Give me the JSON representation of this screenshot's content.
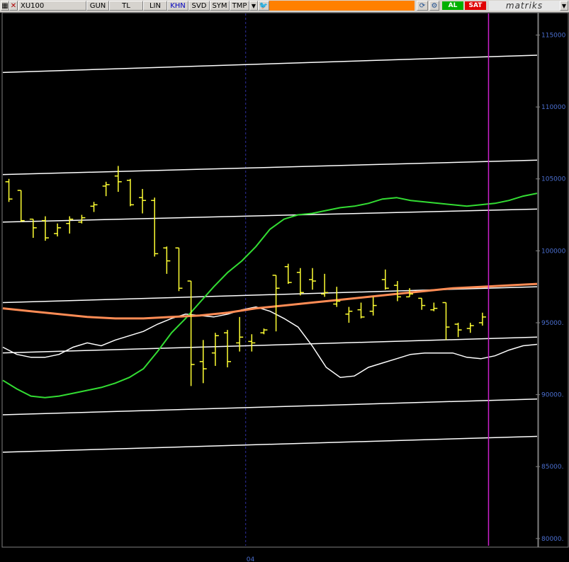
{
  "toolbar": {
    "symbol": "XU100",
    "buttons": [
      "GUN",
      "TL",
      "LIN",
      "KHN",
      "SVD",
      "SYM",
      "TMP"
    ],
    "active_button": "KHN",
    "buy_label": "AL",
    "sell_label": "SAT",
    "brand": "matriks"
  },
  "colors": {
    "price": "#ffff33",
    "channel": "#ffffff",
    "ma_green": "#33dd33",
    "ma_white": "#ffffff",
    "ma_orange": "#ff8c55",
    "cursor": "#cc22cc",
    "grid": "#3030a0",
    "axis_text": "#4b6fd0"
  },
  "chart_data": {
    "type": "ohlc",
    "ylim": [
      79500,
      116500
    ],
    "y_ticks": [
      80000,
      85000,
      90000,
      95000,
      100000,
      105000,
      110000,
      115000
    ],
    "y_tick_labels": [
      "80000.",
      "85000.",
      "90000.",
      "95000.",
      "100000",
      "105000",
      "110000",
      "115000"
    ],
    "x_tick_labels": [
      {
        "index": 20,
        "label": "04"
      }
    ],
    "bar_count": 44,
    "ohlc": [
      [
        104800,
        105000,
        103400,
        103600
      ],
      [
        104200,
        104200,
        102000,
        102100
      ],
      [
        102200,
        102200,
        100900,
        101600
      ],
      [
        102100,
        102400,
        100700,
        100900
      ],
      [
        101200,
        101900,
        101000,
        101600
      ],
      [
        101900,
        102400,
        101200,
        102200
      ],
      [
        102000,
        102500,
        101900,
        102300
      ],
      [
        103100,
        103400,
        102700,
        103200
      ],
      [
        104500,
        104800,
        103800,
        104600
      ],
      [
        105200,
        105900,
        104100,
        104800
      ],
      [
        104900,
        105000,
        103100,
        103200
      ],
      [
        103700,
        104300,
        102600,
        103500
      ],
      [
        103500,
        103700,
        99600,
        99800
      ],
      [
        100200,
        100300,
        98400,
        99300
      ],
      [
        100200,
        100200,
        97200,
        97400
      ],
      [
        97900,
        97900,
        90600,
        92100
      ],
      [
        92300,
        93800,
        90800,
        91800
      ],
      [
        92900,
        94300,
        92000,
        94100
      ],
      [
        94300,
        94500,
        91900,
        92300
      ],
      [
        93600,
        95400,
        93000,
        94000
      ],
      [
        93700,
        94200,
        93000,
        93600
      ],
      [
        94300,
        94600,
        94200,
        94500
      ],
      [
        98300,
        98300,
        94400,
        97400
      ],
      [
        98900,
        99100,
        97700,
        97800
      ],
      [
        98500,
        98800,
        96900,
        97100
      ],
      [
        98000,
        98800,
        97300,
        97900
      ],
      [
        97000,
        98400,
        96800,
        97100
      ],
      [
        96300,
        97500,
        96100,
        96500
      ],
      [
        95600,
        96100,
        95000,
        95800
      ],
      [
        95900,
        96400,
        95300,
        95400
      ],
      [
        95800,
        96800,
        95500,
        96200
      ],
      [
        98000,
        98700,
        97300,
        97400
      ],
      [
        97600,
        97900,
        96500,
        96800
      ],
      [
        96800,
        97400,
        96800,
        97000
      ],
      [
        96700,
        96700,
        95900,
        96200
      ],
      [
        95900,
        96400,
        95800,
        96000
      ],
      [
        96400,
        96400,
        93800,
        94700
      ],
      [
        94900,
        95000,
        94000,
        94500
      ],
      [
        94600,
        95000,
        94300,
        94800
      ],
      [
        95000,
        95700,
        94800,
        95400
      ]
    ],
    "channel_lines": [
      [
        112400,
        113600
      ],
      [
        105300,
        106300
      ],
      [
        102000,
        102900
      ],
      [
        96400,
        97500
      ],
      [
        92900,
        94000
      ],
      [
        88600,
        89700
      ],
      [
        86000,
        87100
      ]
    ],
    "green_line": [
      [
        0,
        91000
      ],
      [
        2,
        90400
      ],
      [
        4,
        89900
      ],
      [
        6,
        89800
      ],
      [
        8,
        89900
      ],
      [
        10,
        90100
      ],
      [
        12,
        90300
      ],
      [
        14,
        90500
      ],
      [
        16,
        90800
      ],
      [
        18,
        91200
      ],
      [
        20,
        91800
      ],
      [
        22,
        93000
      ],
      [
        24,
        94300
      ],
      [
        26,
        95300
      ],
      [
        28,
        96400
      ],
      [
        30,
        97500
      ],
      [
        32,
        98500
      ],
      [
        34,
        99300
      ],
      [
        36,
        100300
      ],
      [
        38,
        101500
      ],
      [
        40,
        102200
      ],
      [
        42,
        102500
      ],
      [
        44,
        102600
      ],
      [
        46,
        102800
      ],
      [
        48,
        103000
      ],
      [
        50,
        103100
      ],
      [
        52,
        103300
      ],
      [
        54,
        103600
      ],
      [
        56,
        103700
      ],
      [
        58,
        103500
      ],
      [
        60,
        103400
      ],
      [
        62,
        103300
      ],
      [
        64,
        103200
      ],
      [
        66,
        103100
      ],
      [
        68,
        103200
      ],
      [
        70,
        103300
      ],
      [
        72,
        103500
      ],
      [
        74,
        103800
      ],
      [
        76,
        104000
      ]
    ],
    "white_line": [
      [
        0,
        93300
      ],
      [
        2,
        92800
      ],
      [
        4,
        92600
      ],
      [
        6,
        92600
      ],
      [
        8,
        92800
      ],
      [
        10,
        93300
      ],
      [
        12,
        93600
      ],
      [
        14,
        93400
      ],
      [
        16,
        93800
      ],
      [
        18,
        94100
      ],
      [
        20,
        94400
      ],
      [
        22,
        94900
      ],
      [
        24,
        95300
      ],
      [
        26,
        95600
      ],
      [
        28,
        95500
      ],
      [
        30,
        95400
      ],
      [
        32,
        95600
      ],
      [
        34,
        95900
      ],
      [
        36,
        96100
      ],
      [
        38,
        95800
      ],
      [
        40,
        95300
      ],
      [
        42,
        94700
      ],
      [
        44,
        93400
      ],
      [
        46,
        91900
      ],
      [
        48,
        91200
      ],
      [
        50,
        91300
      ],
      [
        52,
        91900
      ],
      [
        54,
        92200
      ],
      [
        56,
        92500
      ],
      [
        58,
        92800
      ],
      [
        60,
        92900
      ],
      [
        62,
        92900
      ],
      [
        64,
        92900
      ],
      [
        66,
        92600
      ],
      [
        68,
        92500
      ],
      [
        70,
        92700
      ],
      [
        72,
        93100
      ],
      [
        74,
        93400
      ],
      [
        76,
        93500
      ]
    ],
    "orange_line": [
      [
        0,
        96000
      ],
      [
        4,
        95800
      ],
      [
        8,
        95600
      ],
      [
        12,
        95400
      ],
      [
        16,
        95300
      ],
      [
        20,
        95300
      ],
      [
        24,
        95400
      ],
      [
        28,
        95500
      ],
      [
        32,
        95700
      ],
      [
        36,
        96000
      ],
      [
        40,
        96200
      ],
      [
        44,
        96400
      ],
      [
        48,
        96600
      ],
      [
        52,
        96800
      ],
      [
        56,
        97000
      ],
      [
        60,
        97200
      ],
      [
        64,
        97400
      ],
      [
        68,
        97500
      ],
      [
        72,
        97600
      ],
      [
        76,
        97700
      ]
    ]
  }
}
